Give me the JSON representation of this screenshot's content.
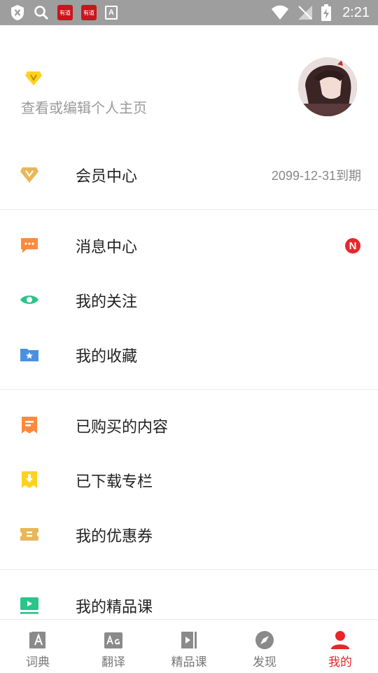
{
  "status_bar": {
    "time": "2:21",
    "app1": "有道",
    "app2": "有道",
    "app3": "A"
  },
  "profile": {
    "link_text": "查看或编辑个人主页"
  },
  "menu": {
    "vip": {
      "label": "会员中心",
      "expiry": "2099-12-31到期"
    },
    "messages": {
      "label": "消息中心",
      "badge": "N"
    },
    "follow": {
      "label": "我的关注"
    },
    "favorites": {
      "label": "我的收藏"
    },
    "purchased": {
      "label": "已购买的内容"
    },
    "downloaded": {
      "label": "已下载专栏"
    },
    "coupons": {
      "label": "我的优惠券"
    },
    "courses": {
      "label": "我的精品课"
    }
  },
  "tabs": [
    {
      "label": "词典",
      "icon": "dictionary-icon"
    },
    {
      "label": "翻译",
      "icon": "translate-icon"
    },
    {
      "label": "精品课",
      "icon": "course-icon"
    },
    {
      "label": "发现",
      "icon": "compass-icon"
    },
    {
      "label": "我的",
      "icon": "person-icon"
    }
  ],
  "colors": {
    "accent": "#e8262b",
    "vip_gold": "#e7b75a",
    "message_orange": "#ff8a3d",
    "eye_green": "#2bc48a",
    "folder_blue": "#4a90e2"
  }
}
